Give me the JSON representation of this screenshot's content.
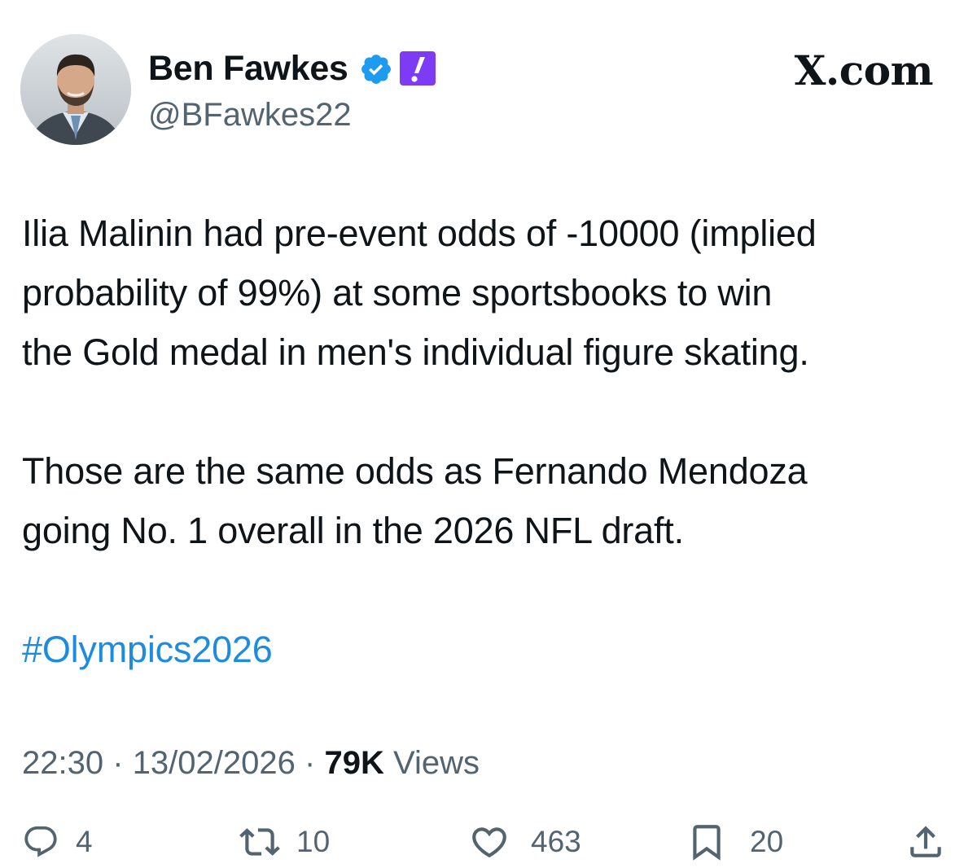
{
  "header": {
    "display_name": "Ben Fawkes",
    "handle": "@BFawkes22",
    "site_logo": "X.com",
    "icons": {
      "verified": "verified-badge-icon",
      "affiliate": "exclamation-badge-icon"
    }
  },
  "tweet": {
    "paragraphs": [
      [
        "Ilia Malinin had pre-event odds of -10000 (implied",
        "probability of 99%) at some sportsbooks to win",
        "the Gold medal in men's individual figure skating."
      ],
      [
        "Those are the same odds as Fernando Mendoza",
        "going No. 1 overall in the 2026 NFL draft."
      ]
    ],
    "hashtag": "#Olympics2026"
  },
  "meta": {
    "time": "22:30",
    "date": "13/02/2026",
    "views_count": "79K",
    "views_label": "Views",
    "separator": "·"
  },
  "actions": {
    "reply_count": "4",
    "repost_count": "10",
    "like_count": "463",
    "bookmark_count": "20"
  },
  "colors": {
    "text": "#0f1419",
    "secondary": "#536471",
    "link": "#1d8be0",
    "verified": "#1d9bf0",
    "affiliate": "#7e3bf5"
  }
}
